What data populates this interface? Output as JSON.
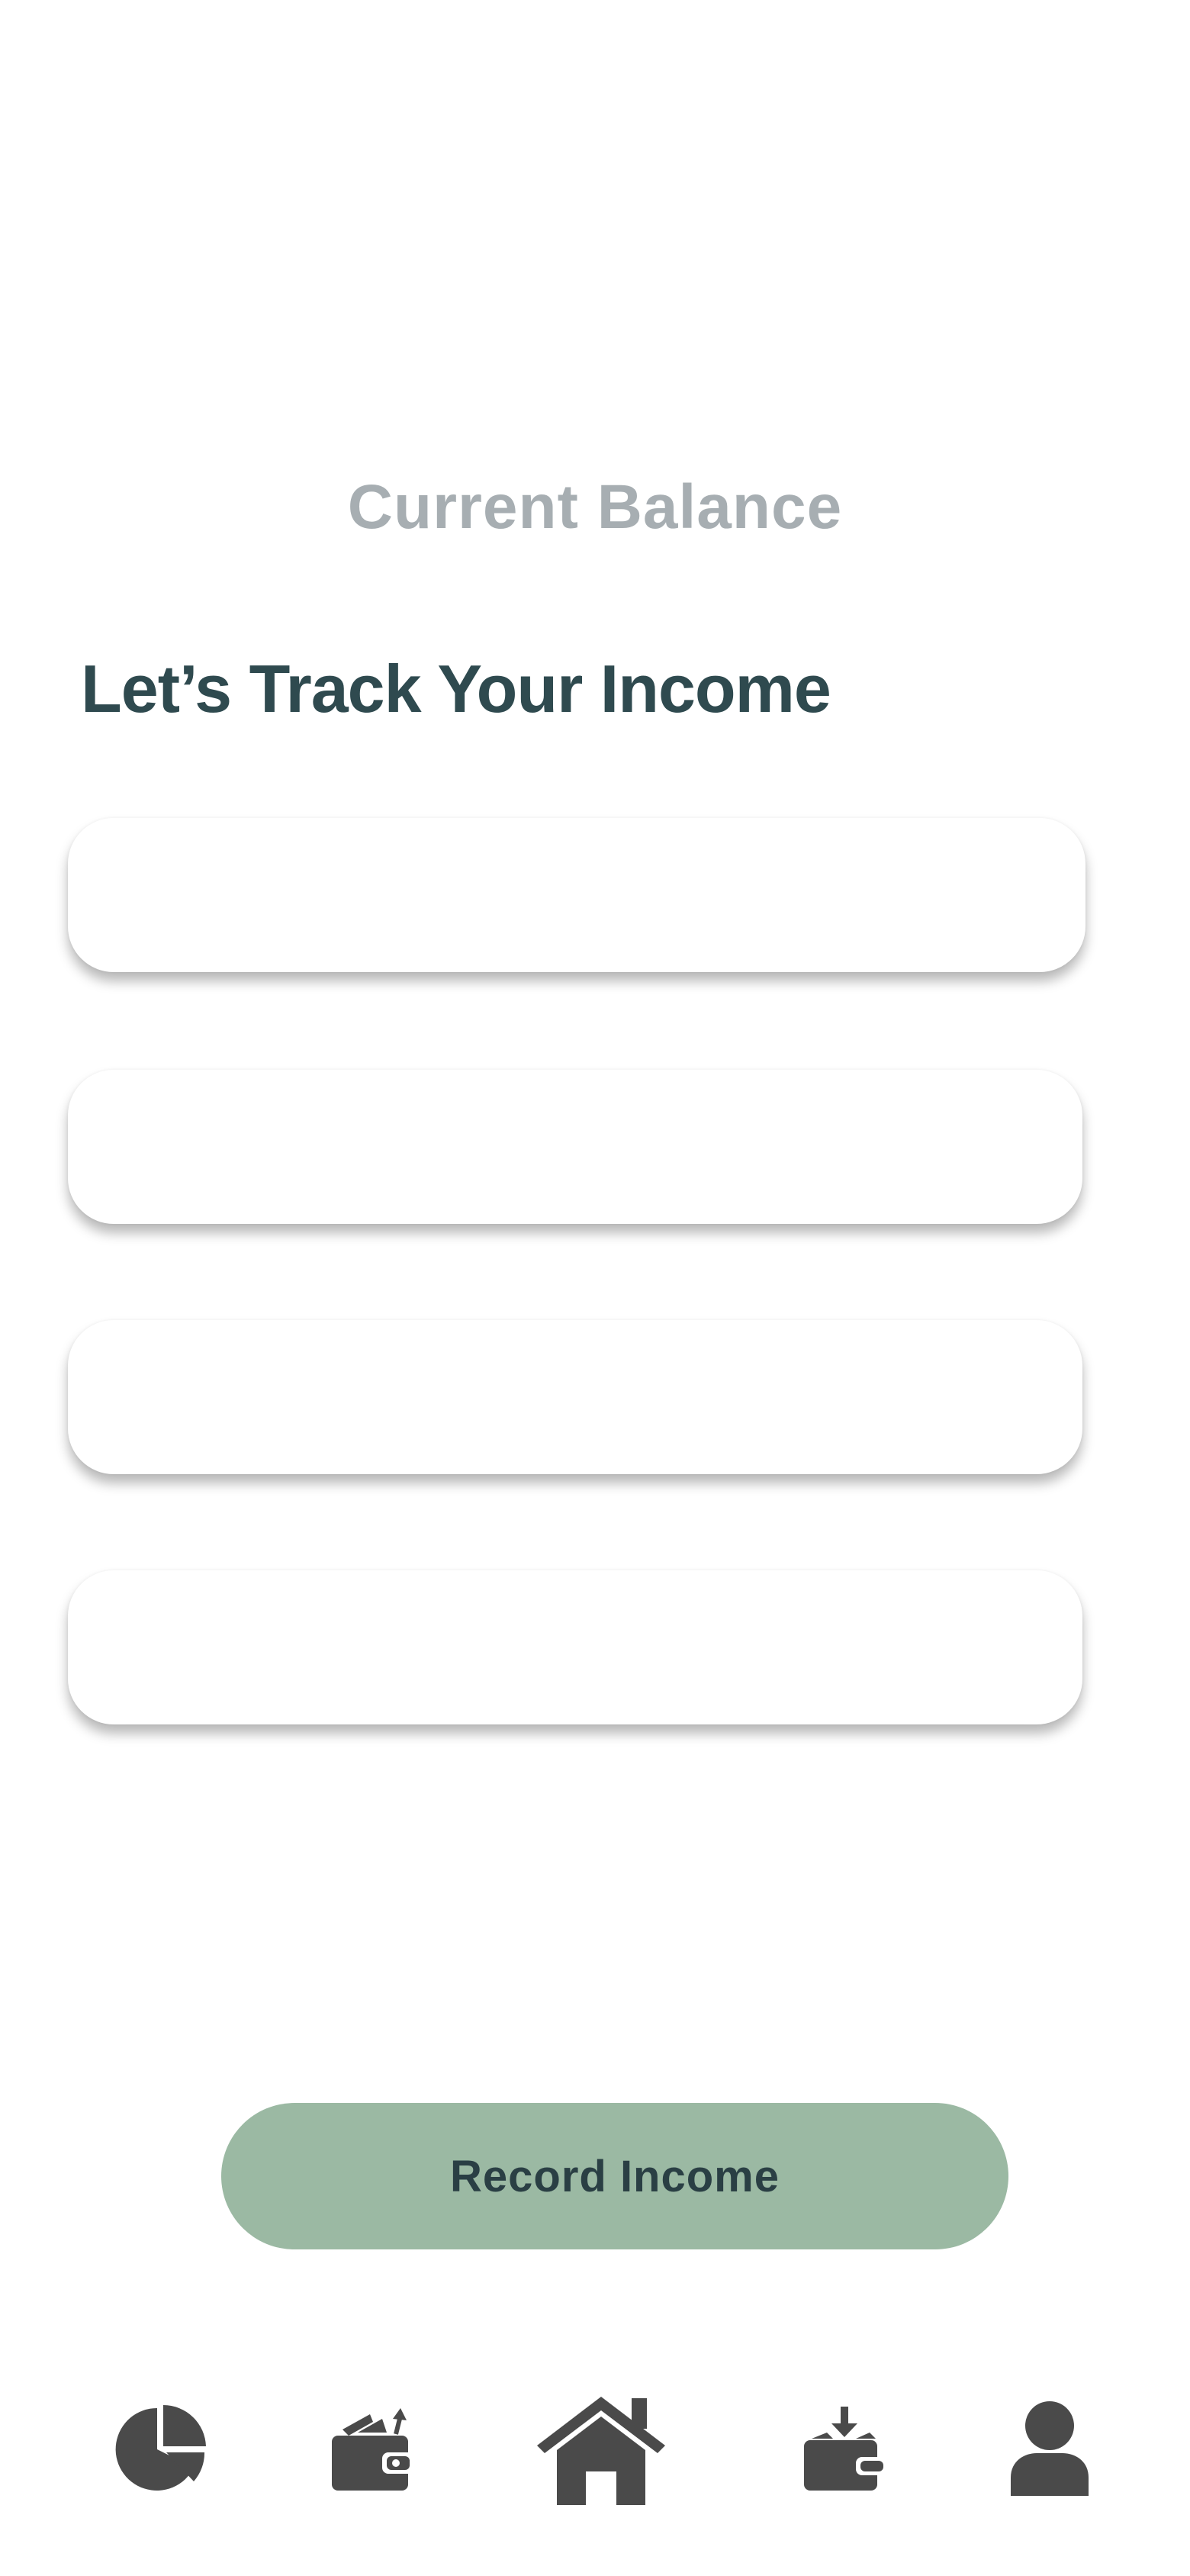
{
  "header": {
    "balance_label": "Current Balance"
  },
  "main": {
    "title": "Let’s Track Your Income",
    "fields": [
      {
        "value": "",
        "placeholder": ""
      },
      {
        "value": "",
        "placeholder": ""
      },
      {
        "value": "",
        "placeholder": ""
      },
      {
        "value": "",
        "placeholder": ""
      }
    ],
    "record_label": "Record Income"
  },
  "nav": {
    "items": [
      {
        "icon": "pie-chart-icon"
      },
      {
        "icon": "wallet-send-icon"
      },
      {
        "icon": "home-icon"
      },
      {
        "icon": "wallet-receive-icon"
      },
      {
        "icon": "user-icon"
      }
    ]
  },
  "colors": {
    "accent_button": "#9bb9a3",
    "title_text": "#2f4a4f",
    "muted_text": "#a7aeb2",
    "icon": "#4a4a4a"
  }
}
